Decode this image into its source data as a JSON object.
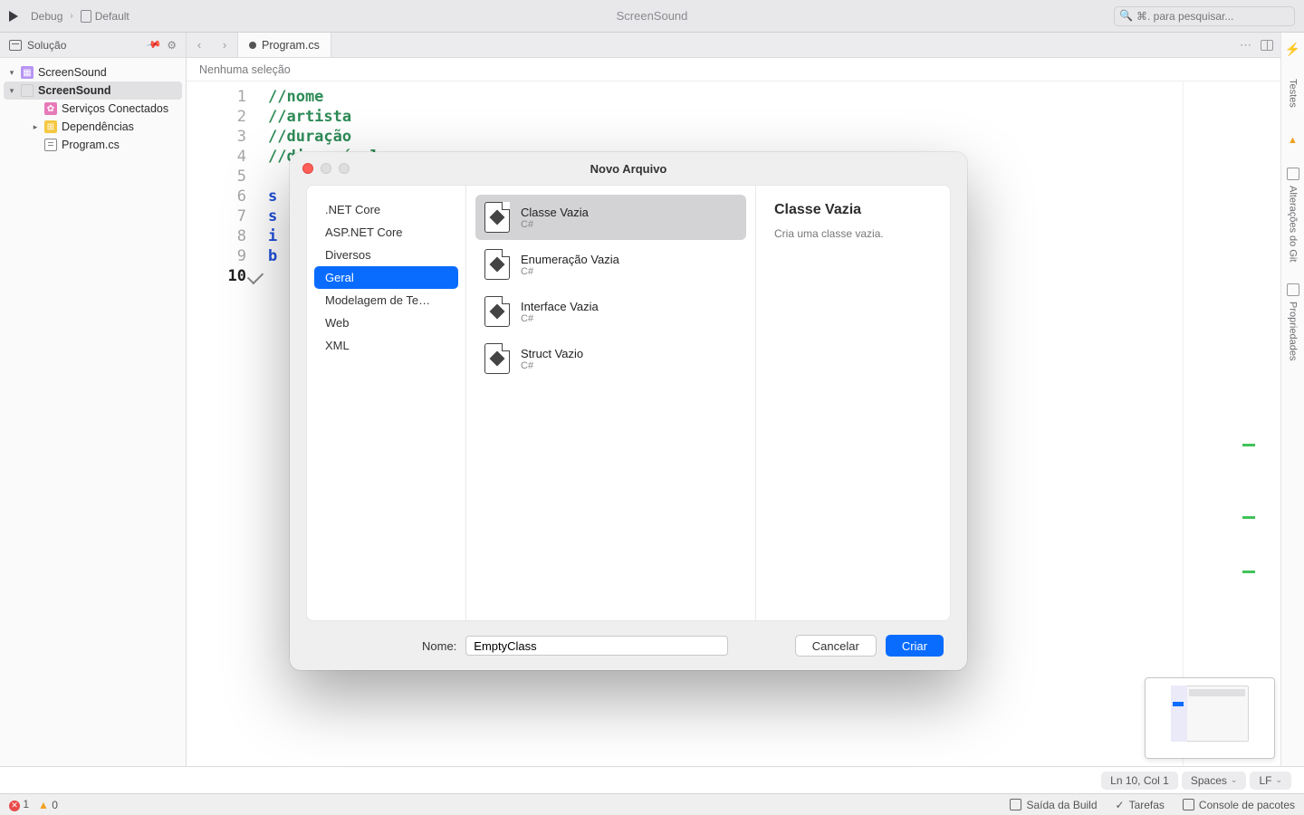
{
  "toolbar": {
    "config": "Debug",
    "target": "Default",
    "title": "ScreenSound",
    "search_placeholder": "⌘. para pesquisar..."
  },
  "sidebar": {
    "header": "Solução",
    "solution": "ScreenSound",
    "project": "ScreenSound",
    "connected": "Serviços Conectados",
    "deps": "Dependências",
    "program": "Program.cs"
  },
  "tabs": {
    "active": "Program.cs"
  },
  "breadcrumb": "Nenhuma seleção",
  "code": {
    "lines": [
      {
        "n": "1",
        "html": "<span class='c-comment'>//nome</span>"
      },
      {
        "n": "2",
        "html": "<span class='c-comment'>//artista</span>"
      },
      {
        "n": "3",
        "html": "<span class='c-comment'>//duração</span>"
      },
      {
        "n": "4",
        "html": "<span class='c-comment'>//disponível</span>"
      },
      {
        "n": "5",
        "html": ""
      },
      {
        "n": "6",
        "html": "<span class='c-kw'>s</span>"
      },
      {
        "n": "7",
        "html": "<span class='c-kw'>s</span>"
      },
      {
        "n": "8",
        "html": "<span class='c-kw'>i</span>"
      },
      {
        "n": "9",
        "html": "<span class='c-kw'>b</span>"
      },
      {
        "n": "10",
        "html": ""
      }
    ]
  },
  "dialog": {
    "title": "Novo Arquivo",
    "categories": [
      ".NET Core",
      "ASP.NET Core",
      "Diversos",
      "Geral",
      "Modelagem de Te…",
      "Web",
      "XML"
    ],
    "selected_category_index": 3,
    "templates": [
      {
        "title": "Classe Vazia",
        "sub": "C#"
      },
      {
        "title": "Enumeração Vazia",
        "sub": "C#"
      },
      {
        "title": "Interface Vazia",
        "sub": "C#"
      },
      {
        "title": "Struct Vazio",
        "sub": "C#"
      }
    ],
    "selected_template_index": 0,
    "detail_title": "Classe Vazia",
    "detail_desc": "Cria uma classe vazia.",
    "name_label": "Nome:",
    "name_value": "EmptyClass",
    "cancel": "Cancelar",
    "create": "Criar"
  },
  "right_panels": [
    "Testes",
    "Alterações do Git",
    "Propriedades"
  ],
  "status": {
    "position": "Ln 10, Col 1",
    "indent": "Spaces",
    "eol": "LF"
  },
  "bottom": {
    "errors": "1",
    "warnings": "0",
    "panels": [
      "Saída da Build",
      "Tarefas",
      "Console de pacotes"
    ]
  }
}
